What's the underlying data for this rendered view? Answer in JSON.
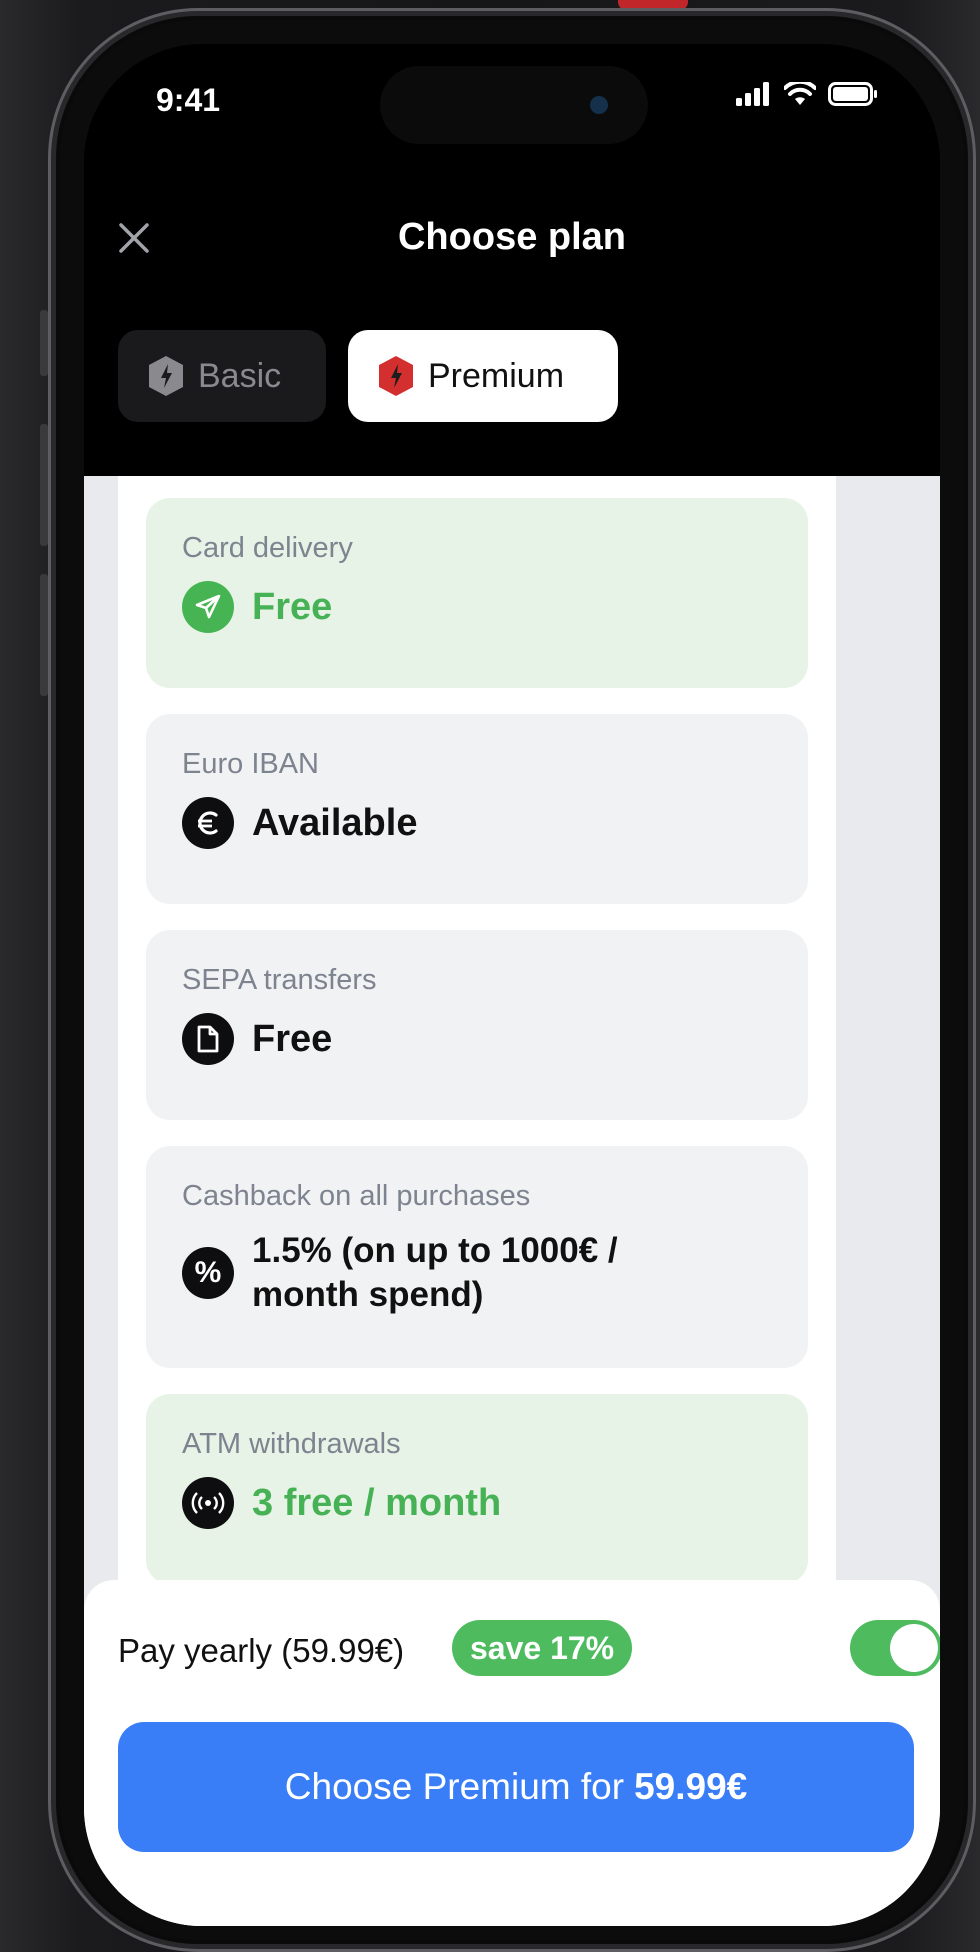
{
  "status": {
    "time": "9:41"
  },
  "header": {
    "title": "Choose plan"
  },
  "tabs": [
    {
      "label": "Basic",
      "selected": false
    },
    {
      "label": "Premium",
      "selected": true
    }
  ],
  "features": [
    {
      "label": "Card delivery",
      "value": "Free",
      "icon": "paper-plane-icon",
      "style": "green"
    },
    {
      "label": "Euro IBAN",
      "value": "Available",
      "icon": "euro-icon",
      "style": "gray"
    },
    {
      "label": "SEPA transfers",
      "value": "Free",
      "icon": "document-icon",
      "style": "gray"
    },
    {
      "label": "Cashback on all purchases",
      "value": "1.5% (on up to 1000€ / month spend)",
      "icon": "percent-icon",
      "style": "gray"
    },
    {
      "label": "ATM withdrawals",
      "value": "3 free / month",
      "icon": "contactless-icon",
      "style": "green"
    }
  ],
  "billing": {
    "pay_label": "Pay yearly (59.99€)",
    "save_badge": "save 17%",
    "yearly_enabled": true
  },
  "cta": {
    "prefix": "Choose Premium for",
    "price": "59.99€"
  },
  "colors": {
    "accent": "#3a7ef7",
    "green": "#4dbb5e",
    "premium_red": "#d32f2f"
  }
}
